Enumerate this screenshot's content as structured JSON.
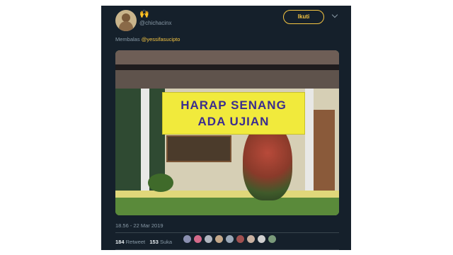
{
  "tweet": {
    "name_emoji": "🙌",
    "username": "@chichacinx",
    "follow_label": "Ikuti",
    "reply_prefix": "Membalas",
    "reply_mention": "@yessifasucipto",
    "image": {
      "banner_line1": "HARAP SENANG",
      "banner_line2": "ADA UJIAN"
    },
    "timestamp": "18.56 - 22 Mar 2019",
    "retweet_count": "184",
    "retweet_label": "Retweet",
    "like_count": "153",
    "like_label": "Suka",
    "liker_avatars": [
      "#8a8fb0",
      "#d46a8a",
      "#b0b6c0",
      "#c4a88a",
      "#9aa7b7",
      "#a05050",
      "#c8b0a0",
      "#d0d0d0",
      "#7a9a7a"
    ]
  },
  "colors": {
    "background": "#15202b",
    "accent": "#f5c542",
    "muted_text": "#8899a6"
  }
}
